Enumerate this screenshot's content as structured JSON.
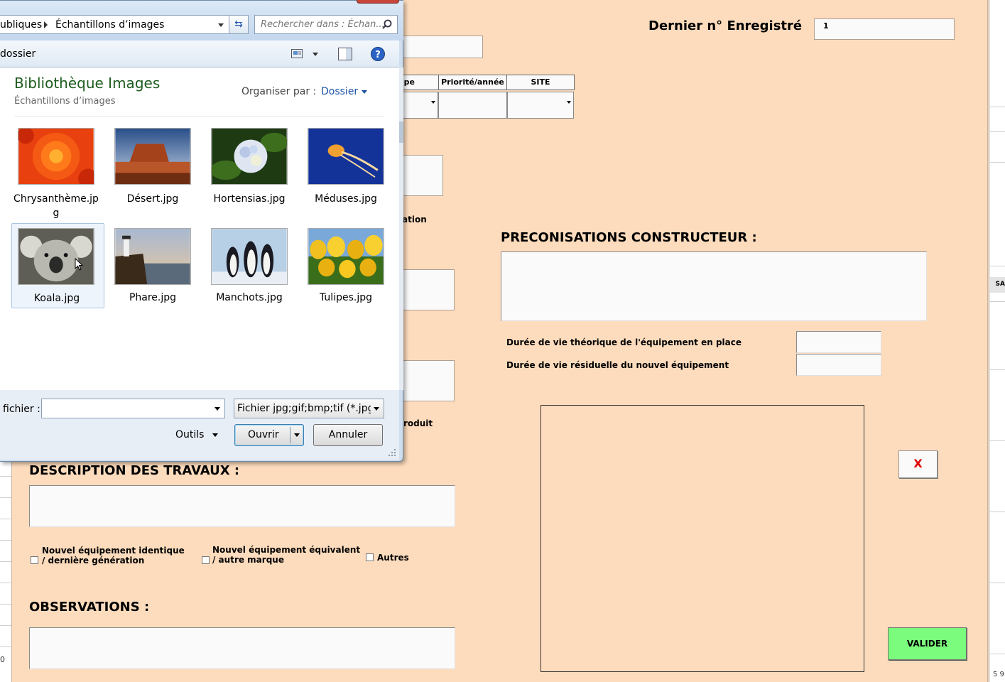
{
  "form": {
    "dernier_label": "Dernier n° Enregistré",
    "dernier_value": "1",
    "col_partial": "pe",
    "col_priorite": "Priorité/année",
    "col_site": "SITE",
    "partial_ation": "ation",
    "partial_roduit": "roduit",
    "preco_title": "PRECONISATIONS CONSTRUCTEUR :",
    "duree_theorique": "Durée de vie théorique de l'équipement en place",
    "duree_residuelle": "Durée de vie résiduelle du nouvel équipement",
    "x_button": "X",
    "desc_title": "DESCRIPTION DES TRAVAUX :",
    "chk1_line1": "Nouvel équipement identique",
    "chk1_line2": "/ dernière génération",
    "chk2_line1": "Nouvel équipement équivalent",
    "chk2_line2": "/ autre marque",
    "chk3": "Autres",
    "obs_title": "OBSERVATIONS :",
    "valider": "VALIDER",
    "right_edge_top": "SA",
    "right_edge_bottom": "5 9",
    "left_edge_bottom": "0"
  },
  "dialog": {
    "breadcrumb_prev": "ubliques",
    "breadcrumb_current": "Échantillons d’images",
    "search_placeholder": "Rechercher dans : Échan...",
    "toolbar_label": "dossier",
    "library_title": "Bibliothèque Images",
    "library_subtitle": "Échantillons d’images",
    "organize_label": "Organiser par :",
    "organize_value": "Dossier",
    "files": [
      {
        "name": "Chrysanthème.jp",
        "name2": "g"
      },
      {
        "name": "Désert.jpg"
      },
      {
        "name": "Hortensias.jpg"
      },
      {
        "name": "Méduses.jpg"
      },
      {
        "name": "Koala.jpg"
      },
      {
        "name": "Phare.jpg"
      },
      {
        "name": "Manchots.jpg"
      },
      {
        "name": "Tulipes.jpg"
      }
    ],
    "filename_label": "fichier :",
    "filename_value": "",
    "filetype_value": "Fichier jpg;gif;bmp;tif (*.jpg;",
    "tools_label": "Outils",
    "open_button": "Ouvrir",
    "cancel_button": "Annuler"
  },
  "colors": {
    "form_bg": "#fddcbd",
    "valider_green": "#7cfc7c",
    "x_red": "#e00000",
    "library_green": "#1e5c1e"
  }
}
